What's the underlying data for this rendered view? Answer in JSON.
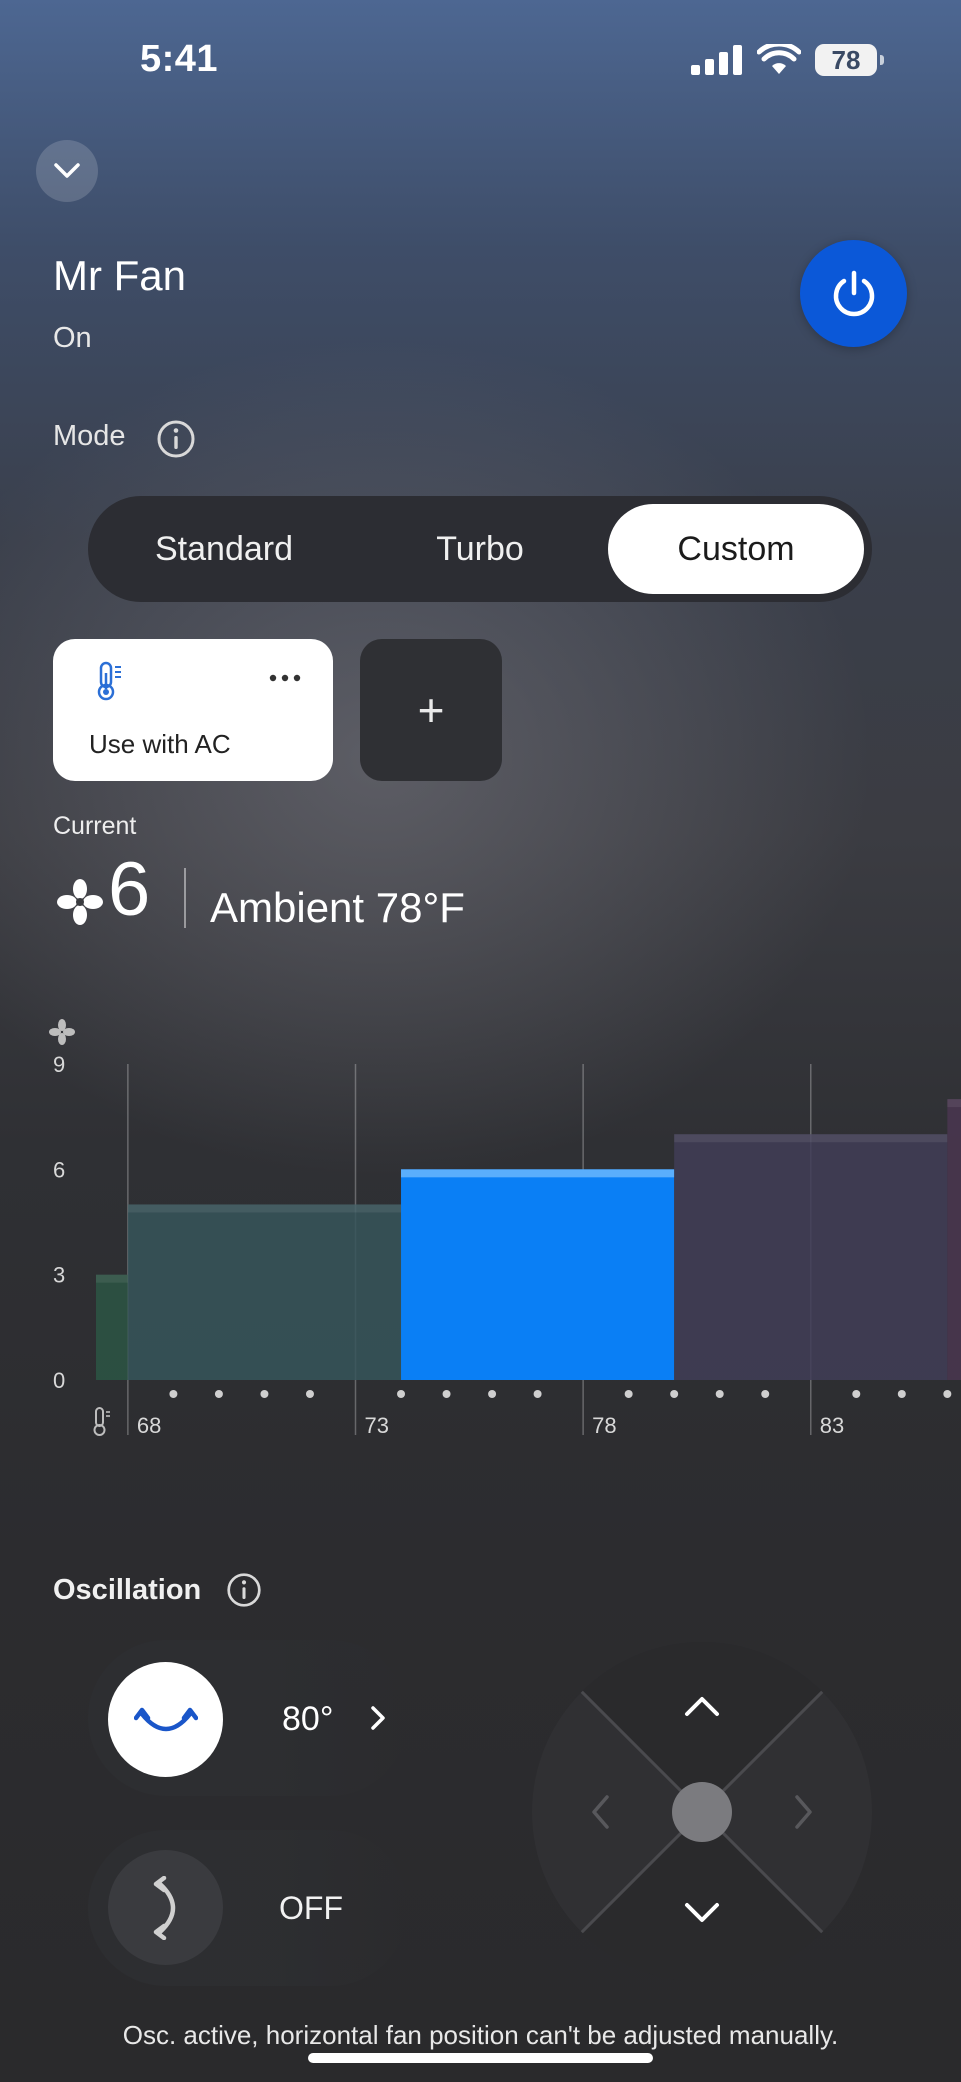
{
  "status_bar": {
    "time": "5:41",
    "battery": "78",
    "icons": [
      "cellular-signal-icon",
      "wifi-icon",
      "battery-icon"
    ]
  },
  "header": {
    "collapse_icon": "chevron-down-icon",
    "device_name": "Mr Fan",
    "device_status": "On",
    "power_icon": "power-icon",
    "power_color": "#0b58d8"
  },
  "mode": {
    "label": "Mode",
    "info_icon": "info-icon",
    "options": [
      "Standard",
      "Turbo",
      "Custom"
    ],
    "selected": "Custom"
  },
  "presets": {
    "items": [
      {
        "label": "Use with AC",
        "icon": "thermometer-icon",
        "more_icon": "more-dots-icon"
      }
    ],
    "add_label": "+"
  },
  "current": {
    "label": "Current",
    "fan_icon": "fan-icon",
    "fan_speed": "6",
    "ambient": "Ambient 78°F"
  },
  "chart_data": {
    "type": "bar",
    "y_icon": "fan-icon",
    "x_icon": "thermometer-icon",
    "ylim": [
      0,
      9
    ],
    "y_ticks": [
      "0",
      "3",
      "6",
      "9"
    ],
    "x_ticks": [
      "68",
      "73",
      "78",
      "83"
    ],
    "xlim": [
      67.3,
      86.3
    ],
    "grid": "vertical",
    "segments": [
      {
        "from": 67.3,
        "to": 68.0,
        "value": 3,
        "color": "#2c5544"
      },
      {
        "from": 68.0,
        "to": 74.0,
        "value": 5,
        "color": "#36555a"
      },
      {
        "from": 74.0,
        "to": 80.0,
        "value": 6,
        "color": "#0a7ff5",
        "active": true
      },
      {
        "from": 80.0,
        "to": 86.0,
        "value": 7,
        "color": "#413d57"
      },
      {
        "from": 86.0,
        "to": 86.7,
        "value": 8,
        "color": "#4a3650"
      }
    ],
    "dot_positions": [
      69,
      70,
      71,
      72,
      74,
      75,
      76,
      77,
      79,
      80,
      81,
      82,
      84,
      85,
      86
    ]
  },
  "oscillation": {
    "label": "Oscillation",
    "info_icon": "info-icon",
    "horizontal_angle": "80°",
    "horizontal_icon": "oscillate-horizontal-icon",
    "vertical_state": "OFF",
    "vertical_icon": "oscillate-vertical-icon"
  },
  "dpad": {
    "up_icon": "chevron-up-icon",
    "down_icon": "chevron-down-icon",
    "left_icon": "chevron-left-icon",
    "right_icon": "chevron-right-icon"
  },
  "footer_note": "Osc. active, horizontal fan position can't be adjusted manually."
}
